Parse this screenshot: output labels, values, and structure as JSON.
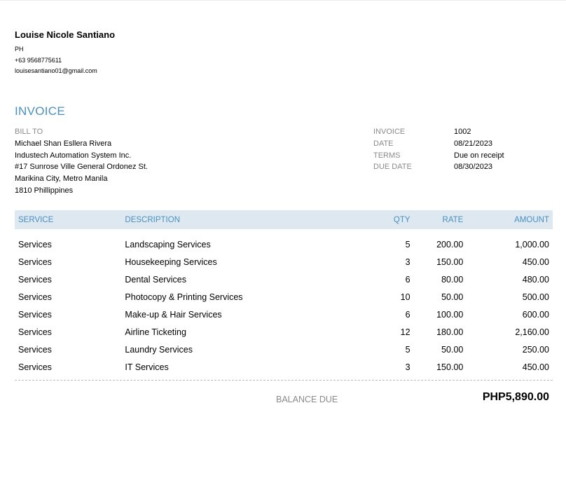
{
  "company": {
    "name": "Louise Nicole Santiano",
    "country": "PH",
    "phone": "+63 9568775611",
    "email": "louisesantiano01@gmail.com"
  },
  "invoice_title": "INVOICE",
  "bill_to": {
    "label": "BILL TO",
    "lines": [
      "Michael Shan Esllera Rivera",
      "Industech Automation System Inc.",
      "#17 Sunrose Ville General Ordonez St.",
      "Marikina City, Metro Manila",
      "1810 Phillippines"
    ]
  },
  "meta": [
    {
      "label": "INVOICE",
      "value": "1002"
    },
    {
      "label": "DATE",
      "value": "08/21/2023"
    },
    {
      "label": "TERMS",
      "value": "Due on receipt"
    },
    {
      "label": "DUE DATE",
      "value": "08/30/2023"
    }
  ],
  "table": {
    "headers": {
      "service": "SERVICE",
      "description": "DESCRIPTION",
      "qty": "QTY",
      "rate": "RATE",
      "amount": "AMOUNT"
    },
    "rows": [
      {
        "service": "Services",
        "description": "Landscaping Services",
        "qty": "5",
        "rate": "200.00",
        "amount": "1,000.00"
      },
      {
        "service": "Services",
        "description": "Housekeeping Services",
        "qty": "3",
        "rate": "150.00",
        "amount": "450.00"
      },
      {
        "service": "Services",
        "description": "Dental Services",
        "qty": "6",
        "rate": "80.00",
        "amount": "480.00"
      },
      {
        "service": "Services",
        "description": "Photocopy & Printing Services",
        "qty": "10",
        "rate": "50.00",
        "amount": "500.00"
      },
      {
        "service": "Services",
        "description": "Make-up & Hair Services",
        "qty": "6",
        "rate": "100.00",
        "amount": "600.00"
      },
      {
        "service": "Services",
        "description": "Airline Ticketing",
        "qty": "12",
        "rate": "180.00",
        "amount": "2,160.00"
      },
      {
        "service": "Services",
        "description": "Laundry Services",
        "qty": "5",
        "rate": "50.00",
        "amount": "250.00"
      },
      {
        "service": "Services",
        "description": "IT Services",
        "qty": "3",
        "rate": "150.00",
        "amount": "450.00"
      }
    ]
  },
  "balance": {
    "label": "BALANCE DUE",
    "value": "PHP5,890.00"
  },
  "colors": {
    "accent": "#4a90c2",
    "header_bg": "#dde8f0",
    "muted": "#8a8a8a"
  }
}
